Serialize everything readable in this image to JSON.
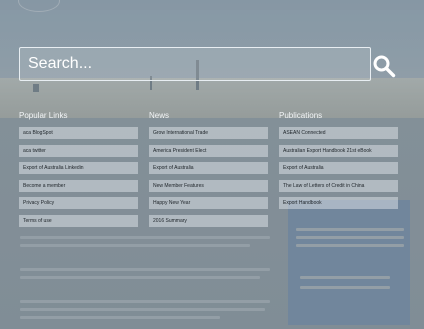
{
  "search": {
    "placeholder": "Search..."
  },
  "icons": {
    "search": "search-icon"
  },
  "columns": [
    {
      "title": "Popular Links",
      "items": [
        "aca BlogSpot",
        "aca twitter",
        "Export of Australia Linkedin",
        "Become a member",
        "Privacy Policy",
        "Terms of use"
      ]
    },
    {
      "title": "News",
      "items": [
        "Grow International Trade",
        "America President Elect",
        "Export of Australia",
        "New Member Features",
        "Happy New Year",
        "2016 Summary"
      ]
    },
    {
      "title": "Publications",
      "items": [
        "ASEAN Connected",
        "Australian Export Handbook 21st eBook",
        "Export of Australia",
        "The Law of Letters of Credit in China",
        "Export Handbook"
      ]
    }
  ]
}
